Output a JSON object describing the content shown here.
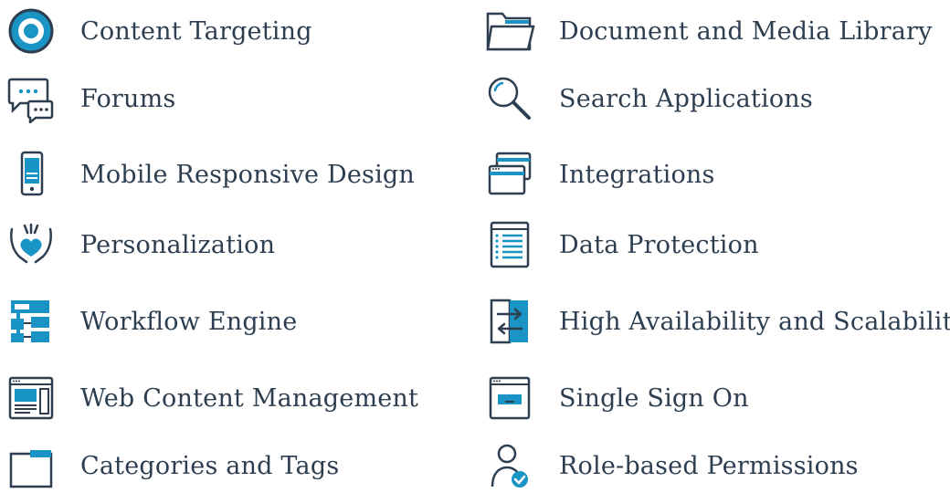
{
  "features": {
    "left": [
      {
        "label": "Content Targeting",
        "icon": "target-icon"
      },
      {
        "label": "Forums",
        "icon": "chat-bubbles-icon"
      },
      {
        "label": "Mobile Responsive Design",
        "icon": "mobile-phone-icon"
      },
      {
        "label": "Personalization",
        "icon": "hands-heart-icon"
      },
      {
        "label": "Workflow Engine",
        "icon": "workflow-icon"
      },
      {
        "label": "Web Content Management",
        "icon": "web-layout-icon"
      },
      {
        "label": "Categories and Tags",
        "icon": "folder-tab-icon"
      }
    ],
    "right": [
      {
        "label": "Document and Media Library",
        "icon": "open-folder-icon"
      },
      {
        "label": "Search Applications",
        "icon": "magnifier-icon"
      },
      {
        "label": "Integrations",
        "icon": "stacked-windows-icon"
      },
      {
        "label": "Data Protection",
        "icon": "list-document-icon"
      },
      {
        "label": "High Availability and Scalability",
        "icon": "swap-arrows-icon"
      },
      {
        "label": "Single Sign On",
        "icon": "browser-key-icon"
      },
      {
        "label": "Role-based Permissions",
        "icon": "user-check-icon"
      }
    ]
  },
  "colors": {
    "navy": "#2c3e50",
    "teal": "#1a94c4"
  }
}
